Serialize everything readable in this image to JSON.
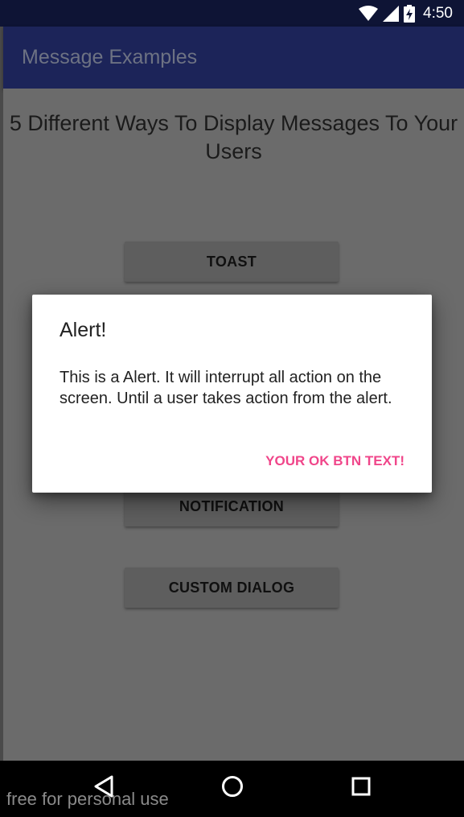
{
  "status_bar": {
    "time": "4:50",
    "icons": [
      "wifi-icon",
      "cell-signal-icon",
      "battery-charging-icon"
    ]
  },
  "app_bar": {
    "title": "Message Examples"
  },
  "main": {
    "heading": "5 Different Ways To Display Messages To Your Users",
    "buttons": [
      {
        "label": "TOAST"
      },
      {
        "label": "NOTIFICATION"
      },
      {
        "label": "CUSTOM DIALOG"
      }
    ]
  },
  "dialog": {
    "title": "Alert!",
    "message": "This is a Alert. It will interrupt all action on the screen. Until a user takes action from the alert.",
    "ok_label": "YOUR OK BTN TEXT!"
  },
  "nav_bar": {
    "icons": [
      "back-icon",
      "home-icon",
      "recents-icon"
    ]
  },
  "watermark": "free for personal use",
  "colors": {
    "status_bar": "#0e1435",
    "app_bar": "#1c2459",
    "accent": "#f0468a",
    "scrim_background": "#6b6b6b"
  }
}
